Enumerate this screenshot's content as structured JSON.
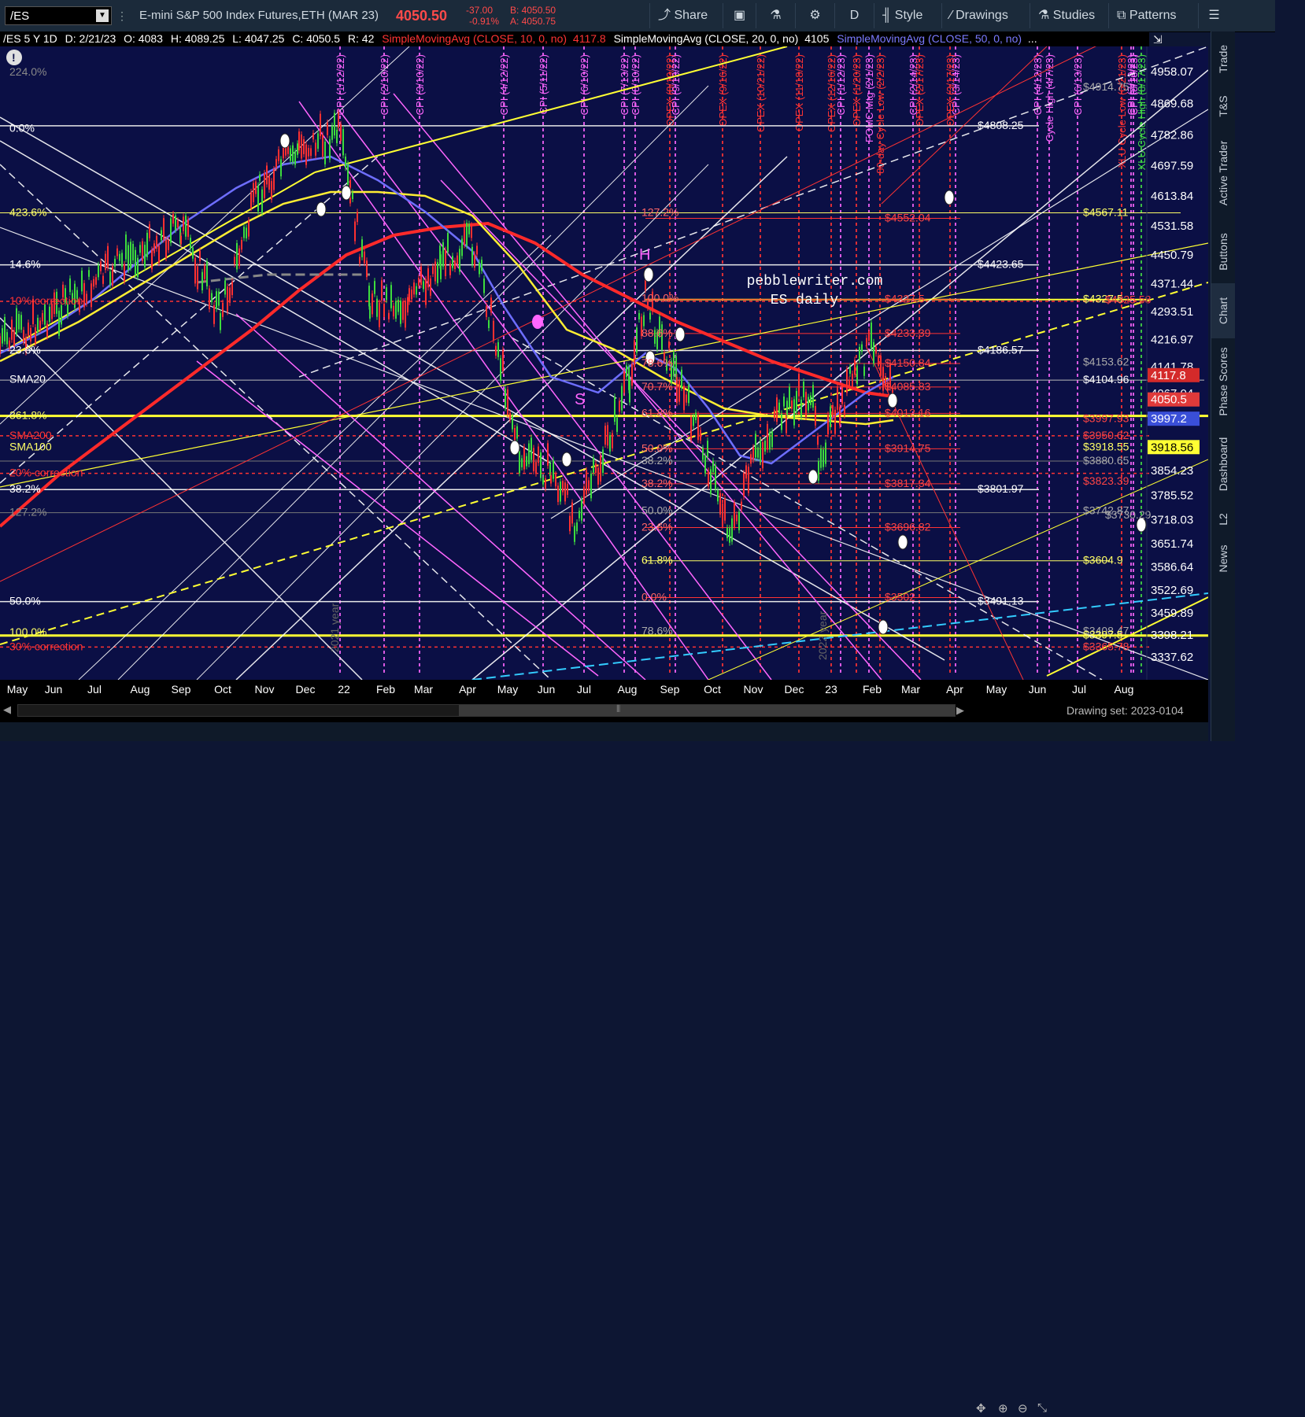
{
  "toolbar": {
    "symbol": "/ES",
    "description": "E-mini S&P 500 Index Futures,ETH (MAR 23)",
    "last_price": "4050.50",
    "change": "-37.00",
    "change_pct": "-0.91%",
    "bid": "B: 4050.50",
    "ask": "A: 4050.75",
    "share": "Share",
    "period": "D",
    "style": "Style",
    "drawings": "Drawings",
    "studies": "Studies",
    "patterns": "Patterns"
  },
  "infobar": {
    "symbol_period": "/ES 5 Y 1D",
    "date": "D: 2/21/23",
    "open": "O: 4083",
    "high": "H: 4089.25",
    "low": "L: 4047.25",
    "close": "C: 4050.5",
    "range": "R: 42",
    "sma10": "SimpleMovingAvg (CLOSE, 10, 0, no)",
    "sma10_val": "4117.8",
    "sma20": "SimpleMovingAvg (CLOSE, 20, 0, no)",
    "sma20_val": "4105",
    "sma50": "SimpleMovingAvg (CLOSE, 50, 0, no)",
    "more": "..."
  },
  "colors": {
    "background": "#0b0f45",
    "toolbar": "#1b2a3a",
    "price_red": "#ff4a4a",
    "yellow": "#ffff33",
    "magenta": "#ff66ff",
    "red": "#ff2a2a",
    "blue_sma": "#6e6eff",
    "cyan": "#33ccff",
    "green": "#44dd44"
  },
  "chart": {
    "watermark_line1": "pebblewriter.com",
    "watermark_line2": "ES daily",
    "year_label": "2021 year",
    "year_label2": "2022 year",
    "h_marker": "H",
    "s_marker": "S",
    "left_labels": [
      {
        "text": "224.0%",
        "price": 4956,
        "color": "#888888"
      },
      {
        "text": "0.0%",
        "price": 4800,
        "color": "#ffffff"
      },
      {
        "text": "423.6%",
        "price": 4567,
        "color": "#ffff66"
      },
      {
        "text": "14.6%",
        "price": 4423,
        "color": "#ffffff"
      },
      {
        "text": "10% correction",
        "price": 4322,
        "color": "#ff3333"
      },
      {
        "text": "23.6%",
        "price": 4186,
        "color": "#ffffff"
      },
      {
        "text": "SMA20",
        "price": 4105,
        "color": "#ffffff"
      },
      {
        "text": "361.8%",
        "price": 4005,
        "color": "#ffff66"
      },
      {
        "text": "SMA200",
        "price": 3950,
        "color": "#ff3333"
      },
      {
        "text": "SMA100",
        "price": 3918,
        "color": "#ffff66"
      },
      {
        "text": "20% correction",
        "price": 3846,
        "color": "#ff3333"
      },
      {
        "text": "38.2%",
        "price": 3801,
        "color": "#ffffff"
      },
      {
        "text": "127.2%",
        "price": 3737,
        "color": "#888888"
      },
      {
        "text": "50.0%",
        "price": 3491,
        "color": "#ffffff"
      },
      {
        "text": "100.0%",
        "price": 3405,
        "color": "#ffff66"
      },
      {
        "text": "30% correction",
        "price": 3365,
        "color": "#ff3333"
      }
    ],
    "mid_labels": [
      {
        "text": "127.2%",
        "price": 4567,
        "color": "#ff6666"
      },
      {
        "text": "100.0%",
        "price": 4330,
        "color": "#ff6666"
      },
      {
        "text": "88.6%",
        "price": 4233,
        "color": "#ff6666"
      },
      {
        "text": "78.6%",
        "price": 4150,
        "color": "#ff6666"
      },
      {
        "text": "70.7%",
        "price": 4085,
        "color": "#ff6666"
      },
      {
        "text": "61.8%",
        "price": 4012,
        "color": "#ff6666"
      },
      {
        "text": "50.0%",
        "price": 3914,
        "color": "#ff6666"
      },
      {
        "text": "38.2%",
        "price": 3880,
        "color": "#aaaaaa"
      },
      {
        "text": "38.2%",
        "price": 3817,
        "color": "#ff6666"
      },
      {
        "text": "50.0%",
        "price": 3742,
        "color": "#aaaaaa"
      },
      {
        "text": "23.6%",
        "price": 3696,
        "color": "#ff6666"
      },
      {
        "text": "61.8%",
        "price": 3604,
        "color": "#ffff66"
      },
      {
        "text": "0.0%",
        "price": 3502,
        "color": "#ff6666"
      },
      {
        "text": "78.6%",
        "price": 3408,
        "color": "#aaaaaa"
      }
    ],
    "right_labels": [
      {
        "text": "$4808.25",
        "price": 4808,
        "color": "#ffffff",
        "pos": "left"
      },
      {
        "text": "$4552.04",
        "price": 4552,
        "color": "#ff4444",
        "pos": "mid"
      },
      {
        "text": "$4567.11",
        "price": 4567,
        "color": "#ffff66",
        "pos": "right"
      },
      {
        "text": "$4423.65",
        "price": 4423,
        "color": "#ffffff",
        "pos": "left"
      },
      {
        "text": "$4327.5",
        "price": 4327,
        "color": "#ff4444",
        "pos": "mid"
      },
      {
        "text": "$4327.5",
        "price": 4327,
        "color": "#ffff66",
        "pos": "right"
      },
      {
        "text": "$4325.58",
        "price": 4325,
        "color": "#ff4444",
        "pos": "right2"
      },
      {
        "text": "$4233.39",
        "price": 4233,
        "color": "#ff4444",
        "pos": "mid"
      },
      {
        "text": "$4186.57",
        "price": 4186,
        "color": "#ffffff",
        "pos": "left"
      },
      {
        "text": "$4150.84",
        "price": 4150,
        "color": "#ff4444",
        "pos": "mid"
      },
      {
        "text": "$4153.62",
        "price": 4153,
        "color": "#aaaaaa",
        "pos": "right"
      },
      {
        "text": "$4104.96",
        "price": 4104,
        "color": "#ffffff",
        "pos": "right"
      },
      {
        "text": "$4085.83",
        "price": 4085,
        "color": "#ff4444",
        "pos": "mid"
      },
      {
        "text": "$4012.16",
        "price": 4012,
        "color": "#ff4444",
        "pos": "mid"
      },
      {
        "text": "$3997.93",
        "price": 3997,
        "color": "#ff4444",
        "pos": "right"
      },
      {
        "text": "$3950.62",
        "price": 3950,
        "color": "#ff4444",
        "pos": "right"
      },
      {
        "text": "$3914.75",
        "price": 3914,
        "color": "#ff4444",
        "pos": "mid"
      },
      {
        "text": "$3918.55",
        "price": 3918,
        "color": "#ffff66",
        "pos": "right"
      },
      {
        "text": "$3880.65",
        "price": 3880,
        "color": "#aaaaaa",
        "pos": "right"
      },
      {
        "text": "$3817.34",
        "price": 3817,
        "color": "#ff4444",
        "pos": "mid"
      },
      {
        "text": "$3801.97",
        "price": 3801,
        "color": "#ffffff",
        "pos": "left"
      },
      {
        "text": "$3823.39",
        "price": 3823,
        "color": "#ff4444",
        "pos": "right"
      },
      {
        "text": "$3742.87",
        "price": 3742,
        "color": "#aaaaaa",
        "pos": "right"
      },
      {
        "text": "$3730.29",
        "price": 3730,
        "color": "#aaaaaa",
        "pos": "right2"
      },
      {
        "text": "$3696.82",
        "price": 3696,
        "color": "#ff4444",
        "pos": "mid"
      },
      {
        "text": "$3604.9",
        "price": 3604,
        "color": "#ffff66",
        "pos": "right"
      },
      {
        "text": "$3502",
        "price": 3502,
        "color": "#ff4444",
        "pos": "mid"
      },
      {
        "text": "$3491.13",
        "price": 3491,
        "color": "#ffffff",
        "pos": "left"
      },
      {
        "text": "$3408.47",
        "price": 3408,
        "color": "#aaaaaa",
        "pos": "right"
      },
      {
        "text": "$3397.5",
        "price": 3397,
        "color": "#ffff66",
        "pos": "right"
      },
      {
        "text": "$3365.78",
        "price": 3365,
        "color": "#ff4444",
        "pos": "right"
      },
      {
        "text": "$4914.75",
        "price": 4914,
        "color": "#aaaaaa",
        "pos": "right"
      }
    ],
    "vertical_events": [
      {
        "text": "CPI (1/12/22)",
        "color": "#ff66ff"
      },
      {
        "text": "CPI (2/10/22)",
        "color": "#ff66ff"
      },
      {
        "text": "CPI (3/10/22)",
        "color": "#ff66ff"
      },
      {
        "text": "CPI (4/12/22)",
        "color": "#ff66ff"
      },
      {
        "text": "CPI (5/11/22)",
        "color": "#ff66ff"
      },
      {
        "text": "CPI (6/10/22)",
        "color": "#ff66ff"
      },
      {
        "text": "CPI (7/13/22)",
        "color": "#ff66ff"
      },
      {
        "text": "CPI (8/10/22)",
        "color": "#ff66ff"
      },
      {
        "text": "OPEX (8/19/22)",
        "color": "#ff3333"
      },
      {
        "text": "CPI (9/13/22)",
        "color": "#ff66ff"
      },
      {
        "text": "OPEX (9/16/22)",
        "color": "#ff3333"
      },
      {
        "text": "OPEX (10/21/22)",
        "color": "#ff3333"
      },
      {
        "text": "OPEX (11/18/22)",
        "color": "#ff3333"
      },
      {
        "text": "OPEX (12/16/22)",
        "color": "#ff3333"
      },
      {
        "text": "CPI (1/12/23)",
        "color": "#ff66ff"
      },
      {
        "text": "OPEX (1/20/23)",
        "color": "#ff3333"
      },
      {
        "text": "FOMC Mtg (2/1/23)",
        "color": "#ff66ff"
      },
      {
        "text": "80-day Cycle Low (2/2/23)",
        "color": "#ff3333"
      },
      {
        "text": "CPI (2/14/23)",
        "color": "#ff66ff"
      },
      {
        "text": "OPEX (2/17/23)",
        "color": "#ff3333"
      },
      {
        "text": "CPI (3/14/23)",
        "color": "#ff66ff"
      },
      {
        "text": "OPEX (3/17/23)",
        "color": "#ff3333"
      },
      {
        "text": "CPI (4/12/23)",
        "color": "#ff66ff"
      },
      {
        "text": "Cycle High (4/7/23)",
        "color": "#ff66ff"
      },
      {
        "text": "CPI (6/13/23)",
        "color": "#ff66ff"
      },
      {
        "text": "XLU Cycle Low (6/21/23)",
        "color": "#ff3333"
      },
      {
        "text": "CPI (7/12/23)",
        "color": "#ff66ff"
      },
      {
        "text": "CPI (8/10/23)",
        "color": "#ff66ff"
      },
      {
        "text": "XLU Cycle High (8/17/23)",
        "color": "#44dd44"
      }
    ]
  },
  "price_axis": {
    "ticks": [
      "4958.07",
      "4869.68",
      "4782.86",
      "4697.59",
      "4613.84",
      "4531.58",
      "4450.79",
      "4371.44",
      "4293.51",
      "4216.97",
      "4141.78",
      "4067.04",
      "3997.2",
      "3918.56",
      "3854.23",
      "3785.52",
      "3718.03",
      "3651.74",
      "3586.64",
      "3522.69",
      "3459.89",
      "3398.21",
      "3337.62"
    ],
    "badges": [
      {
        "text": "4117.8",
        "bg": "#d42a2a",
        "fg": "#ffffff",
        "price": 4117.8
      },
      {
        "text": "4050.5",
        "bg": "#e03a3a",
        "fg": "#ffffff",
        "price": 4050.5
      },
      {
        "text": "3997.2",
        "bg": "#3a4fd8",
        "fg": "#ffffff",
        "price": 3997.2
      },
      {
        "text": "3918.56",
        "bg": "#ffff33",
        "fg": "#000000",
        "price": 3918.56
      }
    ]
  },
  "time_axis": {
    "labels": [
      "May",
      "Jun",
      "Jul",
      "Aug",
      "Sep",
      "Oct",
      "Nov",
      "Dec",
      "22",
      "Feb",
      "Mar",
      "Apr",
      "May",
      "Jun",
      "Jul",
      "Aug",
      "Sep",
      "Oct",
      "Nov",
      "Dec",
      "23",
      "Feb",
      "Mar",
      "Apr",
      "May",
      "Jun",
      "Jul",
      "Aug"
    ]
  },
  "bottom": {
    "drawing_set": "Drawing set: 2023-0104"
  },
  "sidebar": {
    "tabs": [
      "Trade",
      "T&S",
      "Active Trader",
      "Buttons",
      "Chart",
      "Phase Scores",
      "Dashboard",
      "L2",
      "News"
    ]
  }
}
